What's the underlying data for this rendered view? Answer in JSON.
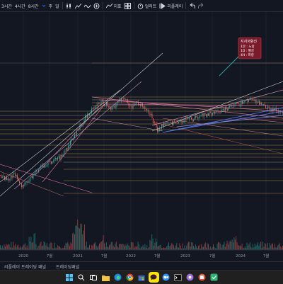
{
  "toolbar": {
    "intervals": [
      "3시간",
      "4시간",
      "8시간"
    ],
    "chart_type_label": "주",
    "extra_label": "일",
    "indicators_label": "지표",
    "alerts_label": "얼러트",
    "replay_label": "리플레이"
  },
  "chart": {
    "x_tick_labels": [
      "2020",
      "7월",
      "2021",
      "7월",
      "2022",
      "7월",
      "2023",
      "7월",
      "2024",
      "7월"
    ],
    "annotation_lines": [
      "지지저항선",
      "1분 : 노랑",
      "1D : 빨강",
      "4H : 파랑"
    ],
    "colors": {
      "background": "#131722",
      "candle_up": "#26a69a",
      "candle_down": "#ef5350",
      "horizontal_lines": "#b8a04a",
      "trendline_pink": "#e27a9e",
      "trendline_blue": "#5b7cfa",
      "trendline_white": "#d8d8d8",
      "annotation_bg": "#7a1a2a"
    }
  },
  "bottom_panel": {
    "tabs": [
      "리플레이 트레이딩 패널",
      "트레이딩패널"
    ]
  },
  "taskbar": {
    "apps": [
      "windows",
      "search",
      "task-view",
      "file-explorer",
      "edge",
      "chrome",
      "store",
      "kakaotalk",
      "zoom",
      "terminal",
      "app",
      "app2",
      "app3"
    ]
  }
}
